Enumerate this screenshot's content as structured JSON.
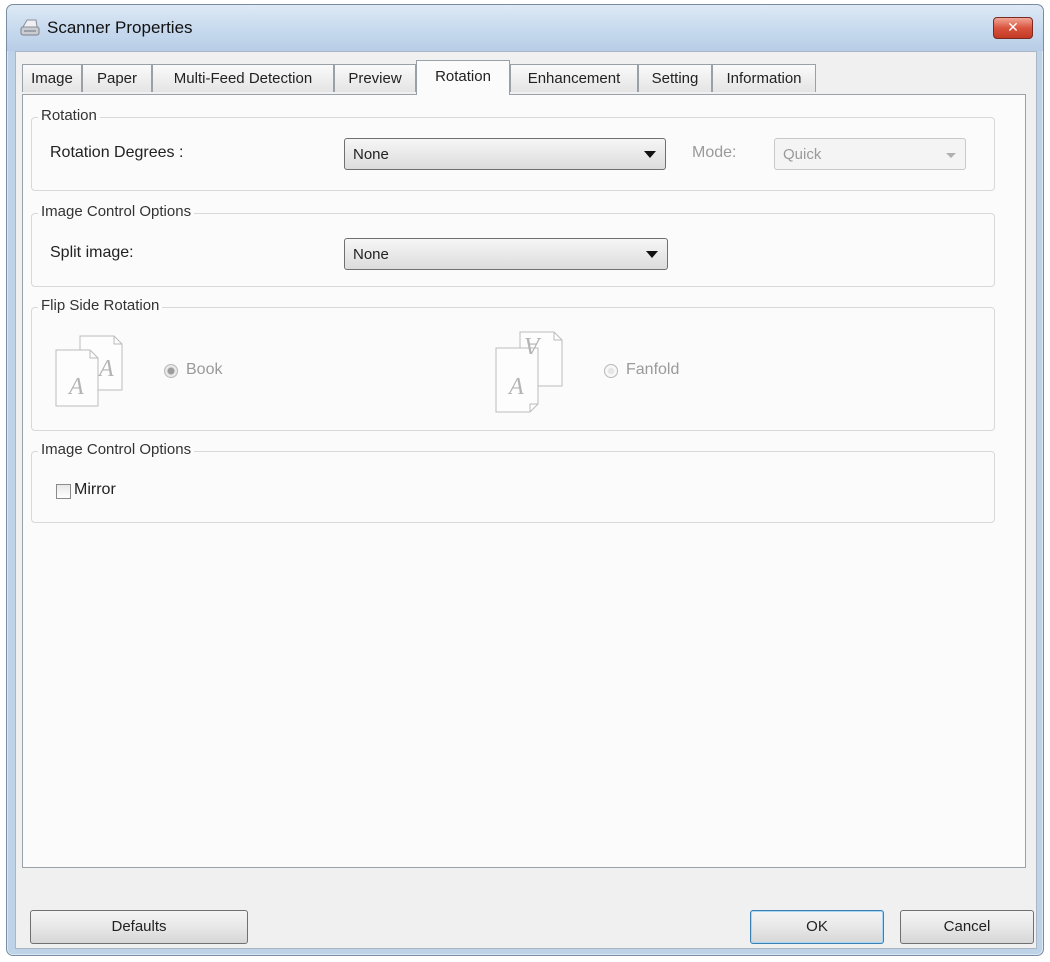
{
  "window": {
    "title": "Scanner Properties",
    "close_label": "✕"
  },
  "tabs": [
    {
      "label": "Image"
    },
    {
      "label": "Paper"
    },
    {
      "label": "Multi-Feed Detection"
    },
    {
      "label": "Preview"
    },
    {
      "label": "Rotation",
      "active": true
    },
    {
      "label": "Enhancement"
    },
    {
      "label": "Setting"
    },
    {
      "label": "Information"
    }
  ],
  "rotation": {
    "group_title": "Rotation",
    "degrees_label": "Rotation Degrees :",
    "degrees_value": "None",
    "mode_label": "Mode:",
    "mode_value": "Quick"
  },
  "image_control_1": {
    "group_title": "Image Control Options",
    "split_label": "Split image:",
    "split_value": "None"
  },
  "flip_side": {
    "group_title": "Flip Side Rotation",
    "book_label": "Book",
    "fanfold_label": "Fanfold",
    "selected": "Book",
    "icon_letter": "A"
  },
  "image_control_2": {
    "group_title": "Image Control Options",
    "mirror_label": "Mirror",
    "mirror_checked": false
  },
  "buttons": {
    "defaults": "Defaults",
    "ok": "OK",
    "cancel": "Cancel"
  }
}
